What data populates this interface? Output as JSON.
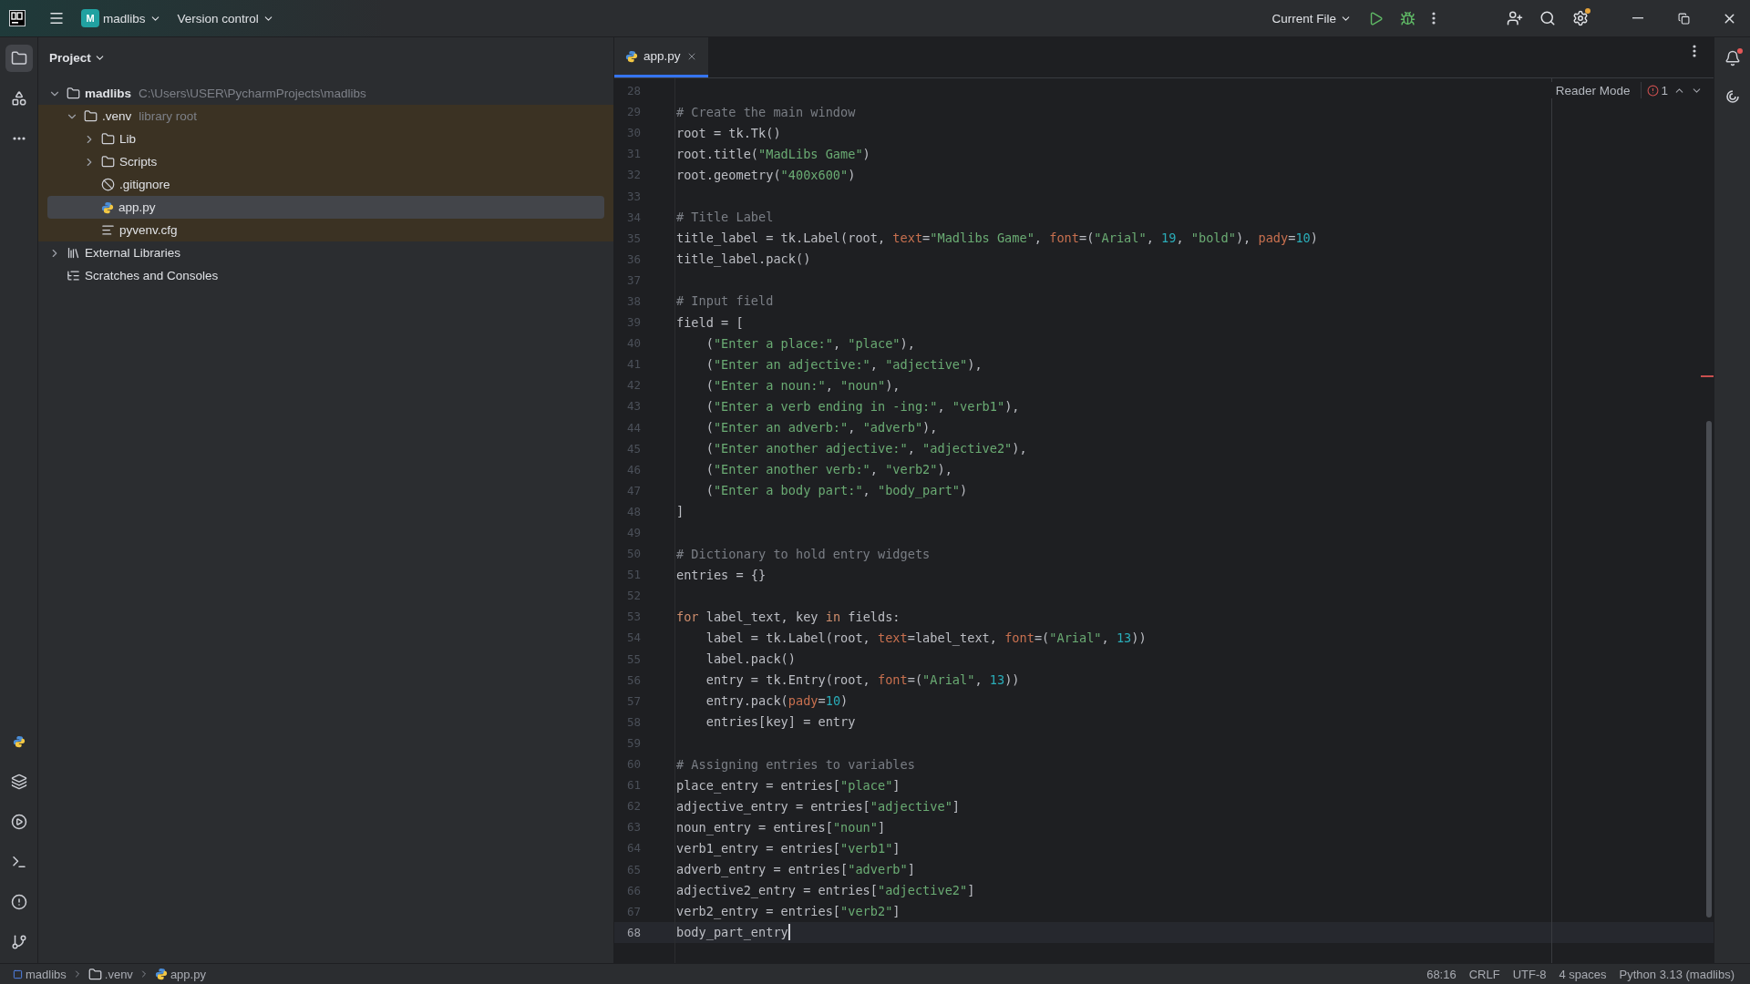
{
  "title_bar": {
    "project_badge": "M",
    "project": "madlibs",
    "vcs": "Version control",
    "run_config": "Current File"
  },
  "project_panel": {
    "title": "Project",
    "tree": [
      {
        "kind": "folder",
        "name": "madlibs",
        "hint": "C:\\Users\\USER\\PycharmProjects\\madlibs",
        "expanded": true,
        "selected": false,
        "children": [
          {
            "kind": "library-folder",
            "name": ".venv",
            "hint": "library root",
            "expanded": true,
            "selected": false,
            "children": [
              {
                "kind": "folder",
                "name": "Lib",
                "expanded": false,
                "selected": false
              },
              {
                "kind": "folder",
                "name": "Scripts",
                "expanded": false,
                "selected": false
              },
              {
                "kind": "ignore-file",
                "name": ".gitignore",
                "selected": false
              },
              {
                "kind": "python-file",
                "name": "app.py",
                "selected": true
              },
              {
                "kind": "text-file",
                "name": "pyvenv.cfg",
                "selected": false
              }
            ]
          }
        ]
      },
      {
        "kind": "libraries",
        "name": "External Libraries",
        "expanded": false,
        "selected": false
      },
      {
        "kind": "scratches",
        "name": "Scratches and Consoles",
        "selected": false
      }
    ]
  },
  "editor": {
    "tabs": [
      {
        "label": "app.py",
        "selected": true
      }
    ],
    "reader_mode": "Reader Mode",
    "problem_count": "1",
    "lines": [
      {
        "number": "28",
        "current": false
      },
      {
        "number": "29",
        "current": false,
        "tokens": [
          {
            "kind": "comment",
            "text": "# Create the main window"
          }
        ]
      },
      {
        "number": "30",
        "current": false,
        "tokens": [
          {
            "kind": "plain",
            "text": "root = tk.Tk()"
          }
        ]
      },
      {
        "number": "31",
        "current": false,
        "tokens": [
          {
            "kind": "plain",
            "text": "root.title("
          },
          {
            "kind": "string",
            "text": "\"MadLibs Game\""
          },
          {
            "kind": "plain",
            "text": ")"
          }
        ]
      },
      {
        "number": "32",
        "current": false,
        "tokens": [
          {
            "kind": "plain",
            "text": "root.geometry("
          },
          {
            "kind": "string",
            "text": "\"400x600\""
          },
          {
            "kind": "plain",
            "text": ")"
          }
        ]
      },
      {
        "number": "33",
        "current": false
      },
      {
        "number": "34",
        "current": false,
        "tokens": [
          {
            "kind": "comment",
            "text": "# Title Label"
          }
        ]
      },
      {
        "number": "35",
        "current": false,
        "tokens": [
          {
            "kind": "plain",
            "text": "title_label = tk.Label(root, "
          },
          {
            "kind": "kwarg",
            "text": "text"
          },
          {
            "kind": "plain",
            "text": "="
          },
          {
            "kind": "string",
            "text": "\"Madlibs Game\""
          },
          {
            "kind": "plain",
            "text": ", "
          },
          {
            "kind": "kwarg",
            "text": "font"
          },
          {
            "kind": "plain",
            "text": "=("
          },
          {
            "kind": "string",
            "text": "\"Arial\""
          },
          {
            "kind": "plain",
            "text": ", "
          },
          {
            "kind": "number",
            "text": "19"
          },
          {
            "kind": "plain",
            "text": ", "
          },
          {
            "kind": "string",
            "text": "\"bold\""
          },
          {
            "kind": "plain",
            "text": "), "
          },
          {
            "kind": "kwarg",
            "text": "pady"
          },
          {
            "kind": "plain",
            "text": "="
          },
          {
            "kind": "number",
            "text": "10"
          },
          {
            "kind": "plain",
            "text": ")"
          }
        ]
      },
      {
        "number": "36",
        "current": false,
        "tokens": [
          {
            "kind": "plain",
            "text": "title_label.pack()"
          }
        ]
      },
      {
        "number": "37",
        "current": false
      },
      {
        "number": "38",
        "current": false,
        "tokens": [
          {
            "kind": "comment",
            "text": "# Input field"
          }
        ]
      },
      {
        "number": "39",
        "current": false,
        "tokens": [
          {
            "kind": "plain",
            "text": "field = ["
          }
        ]
      },
      {
        "number": "40",
        "current": false,
        "tokens": [
          {
            "kind": "plain",
            "text": "    ("
          },
          {
            "kind": "string",
            "text": "\"Enter a place:\""
          },
          {
            "kind": "plain",
            "text": ", "
          },
          {
            "kind": "string",
            "text": "\"place\""
          },
          {
            "kind": "plain",
            "text": "),"
          }
        ]
      },
      {
        "number": "41",
        "current": false,
        "tokens": [
          {
            "kind": "plain",
            "text": "    ("
          },
          {
            "kind": "string",
            "text": "\"Enter an adjective:\""
          },
          {
            "kind": "plain",
            "text": ", "
          },
          {
            "kind": "string",
            "text": "\"adjective\""
          },
          {
            "kind": "plain",
            "text": "),"
          }
        ]
      },
      {
        "number": "42",
        "current": false,
        "tokens": [
          {
            "kind": "plain",
            "text": "    ("
          },
          {
            "kind": "string",
            "text": "\"Enter a noun:\""
          },
          {
            "kind": "plain",
            "text": ", "
          },
          {
            "kind": "string",
            "text": "\"noun\""
          },
          {
            "kind": "plain",
            "text": "),"
          }
        ]
      },
      {
        "number": "43",
        "current": false,
        "tokens": [
          {
            "kind": "plain",
            "text": "    ("
          },
          {
            "kind": "string",
            "text": "\"Enter a verb ending in -ing:\""
          },
          {
            "kind": "plain",
            "text": ", "
          },
          {
            "kind": "string",
            "text": "\"verb1\""
          },
          {
            "kind": "plain",
            "text": "),"
          }
        ]
      },
      {
        "number": "44",
        "current": false,
        "tokens": [
          {
            "kind": "plain",
            "text": "    ("
          },
          {
            "kind": "string",
            "text": "\"Enter an adverb:\""
          },
          {
            "kind": "plain",
            "text": ", "
          },
          {
            "kind": "string",
            "text": "\"adverb\""
          },
          {
            "kind": "plain",
            "text": "),"
          }
        ]
      },
      {
        "number": "45",
        "current": false,
        "tokens": [
          {
            "kind": "plain",
            "text": "    ("
          },
          {
            "kind": "string",
            "text": "\"Enter another adjective:\""
          },
          {
            "kind": "plain",
            "text": ", "
          },
          {
            "kind": "string",
            "text": "\"adjective2\""
          },
          {
            "kind": "plain",
            "text": "),"
          }
        ]
      },
      {
        "number": "46",
        "current": false,
        "tokens": [
          {
            "kind": "plain",
            "text": "    ("
          },
          {
            "kind": "string",
            "text": "\"Enter another verb:\""
          },
          {
            "kind": "plain",
            "text": ", "
          },
          {
            "kind": "string",
            "text": "\"verb2\""
          },
          {
            "kind": "plain",
            "text": "),"
          }
        ]
      },
      {
        "number": "47",
        "current": false,
        "tokens": [
          {
            "kind": "plain",
            "text": "    ("
          },
          {
            "kind": "string",
            "text": "\"Enter a body part:\""
          },
          {
            "kind": "plain",
            "text": ", "
          },
          {
            "kind": "string",
            "text": "\"body_part\""
          },
          {
            "kind": "plain",
            "text": ")"
          }
        ]
      },
      {
        "number": "48",
        "current": false,
        "tokens": [
          {
            "kind": "plain",
            "text": "]"
          }
        ]
      },
      {
        "number": "49",
        "current": false
      },
      {
        "number": "50",
        "current": false,
        "tokens": [
          {
            "kind": "comment",
            "text": "# Dictionary to hold entry widgets"
          }
        ]
      },
      {
        "number": "51",
        "current": false,
        "tokens": [
          {
            "kind": "plain",
            "text": "entries = {}"
          }
        ]
      },
      {
        "number": "52",
        "current": false
      },
      {
        "number": "53",
        "current": false,
        "tokens": [
          {
            "kind": "keyword",
            "text": "for"
          },
          {
            "kind": "plain",
            "text": " label_text, key "
          },
          {
            "kind": "keyword",
            "text": "in"
          },
          {
            "kind": "plain",
            "text": " fields:"
          }
        ]
      },
      {
        "number": "54",
        "current": false,
        "tokens": [
          {
            "kind": "plain",
            "text": "    label = tk.Label(root, "
          },
          {
            "kind": "kwarg",
            "text": "text"
          },
          {
            "kind": "plain",
            "text": "=label_text, "
          },
          {
            "kind": "kwarg",
            "text": "font"
          },
          {
            "kind": "plain",
            "text": "=("
          },
          {
            "kind": "string",
            "text": "\"Arial\""
          },
          {
            "kind": "plain",
            "text": ", "
          },
          {
            "kind": "number",
            "text": "13"
          },
          {
            "kind": "plain",
            "text": "))"
          }
        ]
      },
      {
        "number": "55",
        "current": false,
        "tokens": [
          {
            "kind": "plain",
            "text": "    label.pack()"
          }
        ]
      },
      {
        "number": "56",
        "current": false,
        "tokens": [
          {
            "kind": "plain",
            "text": "    entry = tk.Entry(root, "
          },
          {
            "kind": "kwarg",
            "text": "font"
          },
          {
            "kind": "plain",
            "text": "=("
          },
          {
            "kind": "string",
            "text": "\"Arial\""
          },
          {
            "kind": "plain",
            "text": ", "
          },
          {
            "kind": "number",
            "text": "13"
          },
          {
            "kind": "plain",
            "text": "))"
          }
        ]
      },
      {
        "number": "57",
        "current": false,
        "tokens": [
          {
            "kind": "plain",
            "text": "    entry.pack("
          },
          {
            "kind": "kwarg",
            "text": "pady"
          },
          {
            "kind": "plain",
            "text": "="
          },
          {
            "kind": "number",
            "text": "10"
          },
          {
            "kind": "plain",
            "text": ")"
          }
        ]
      },
      {
        "number": "58",
        "current": false,
        "tokens": [
          {
            "kind": "plain",
            "text": "    entries[key] = entry"
          }
        ]
      },
      {
        "number": "59",
        "current": false
      },
      {
        "number": "60",
        "current": false,
        "tokens": [
          {
            "kind": "comment",
            "text": "# Assigning entries to variables"
          }
        ]
      },
      {
        "number": "61",
        "current": false,
        "tokens": [
          {
            "kind": "plain",
            "text": "place_entry = entries["
          },
          {
            "kind": "string",
            "text": "\"place\""
          },
          {
            "kind": "plain",
            "text": "]"
          }
        ]
      },
      {
        "number": "62",
        "current": false,
        "tokens": [
          {
            "kind": "plain",
            "text": "adjective_entry = entries["
          },
          {
            "kind": "string",
            "text": "\"adjective\""
          },
          {
            "kind": "plain",
            "text": "]"
          }
        ]
      },
      {
        "number": "63",
        "current": false,
        "tokens": [
          {
            "kind": "plain",
            "text": "noun_entry = entires["
          },
          {
            "kind": "string",
            "text": "\"noun\""
          },
          {
            "kind": "plain",
            "text": "]"
          }
        ]
      },
      {
        "number": "64",
        "current": false,
        "tokens": [
          {
            "kind": "plain",
            "text": "verb1_entry = entries["
          },
          {
            "kind": "string",
            "text": "\"verb1\""
          },
          {
            "kind": "plain",
            "text": "]"
          }
        ]
      },
      {
        "number": "65",
        "current": false,
        "tokens": [
          {
            "kind": "plain",
            "text": "adverb_entry = entries["
          },
          {
            "kind": "string",
            "text": "\"adverb\""
          },
          {
            "kind": "plain",
            "text": "]"
          }
        ]
      },
      {
        "number": "66",
        "current": false,
        "tokens": [
          {
            "kind": "plain",
            "text": "adjective2_entry = entries["
          },
          {
            "kind": "string",
            "text": "\"adjective2\""
          },
          {
            "kind": "plain",
            "text": "]"
          }
        ]
      },
      {
        "number": "67",
        "current": false,
        "tokens": [
          {
            "kind": "plain",
            "text": "verb2_entry = entries["
          },
          {
            "kind": "string",
            "text": "\"verb2\""
          },
          {
            "kind": "plain",
            "text": "]"
          }
        ]
      },
      {
        "number": "68",
        "current": true,
        "tokens": [
          {
            "kind": "plain",
            "text": "body_part_entry"
          }
        ]
      }
    ]
  },
  "status_bar": {
    "breadcrumbs": [
      {
        "kind": "module",
        "label": "madlibs"
      },
      {
        "kind": "folder",
        "label": ".venv"
      },
      {
        "kind": "python-file",
        "label": "app.py"
      }
    ],
    "items": [
      "68:16",
      "CRLF",
      "UTF-8",
      "4 spaces",
      "Python 3.13 (madlibs)"
    ]
  }
}
